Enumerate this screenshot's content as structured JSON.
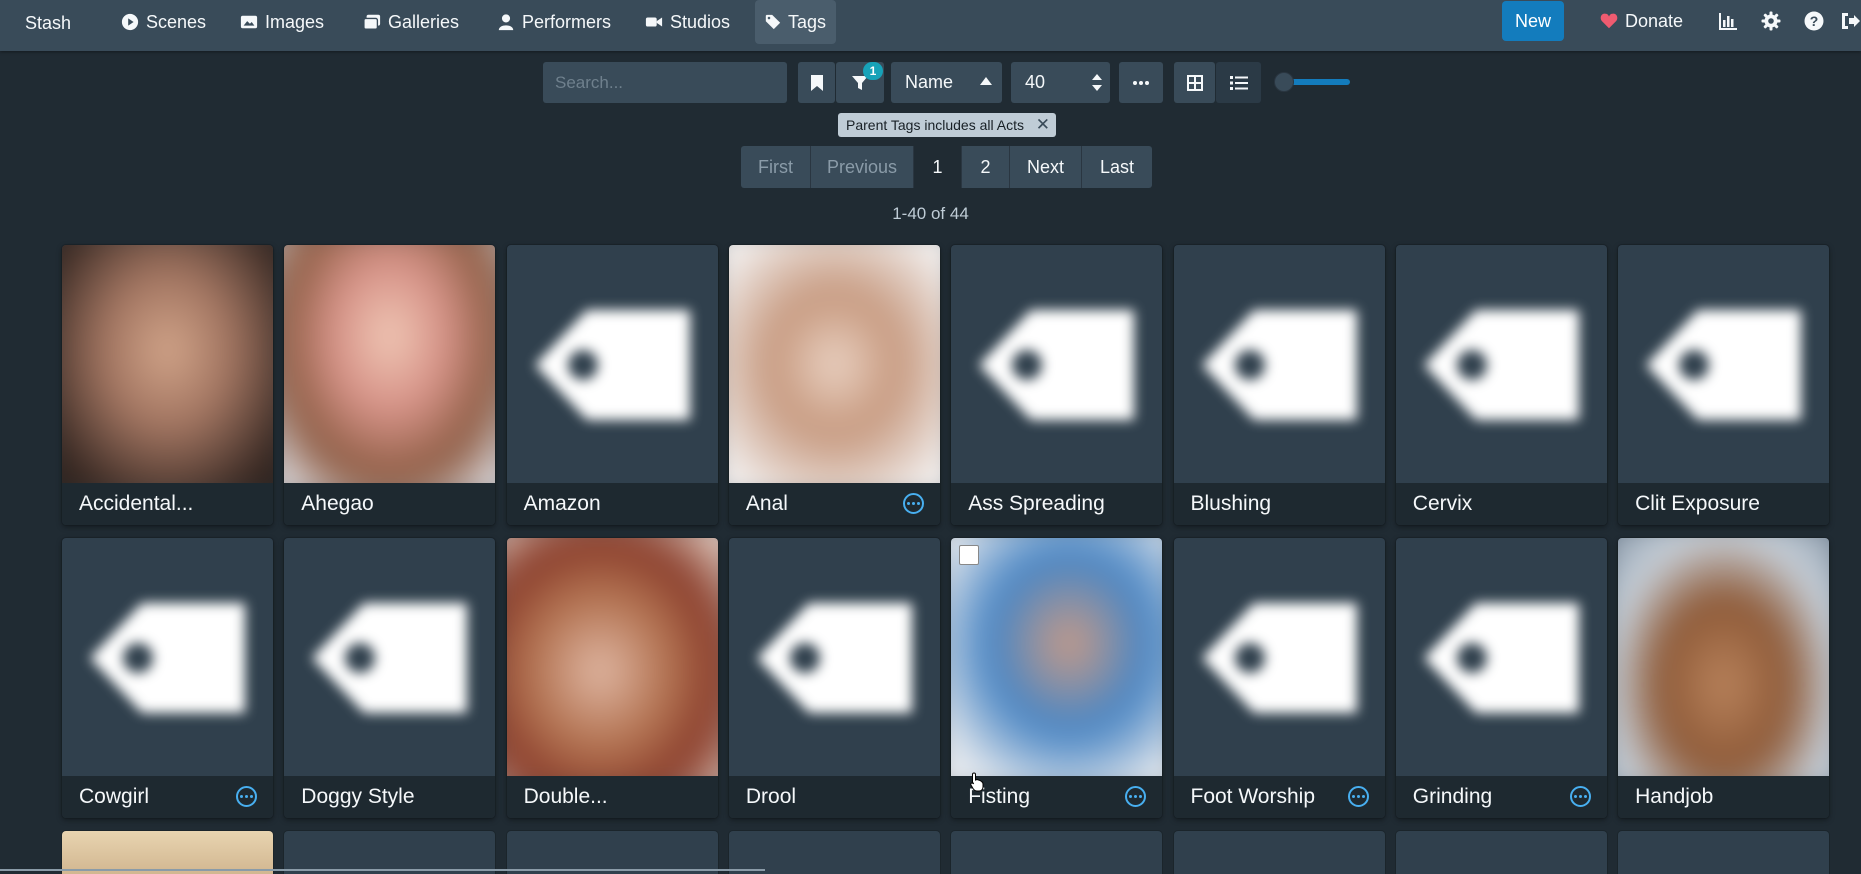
{
  "navbar": {
    "brand": "Stash",
    "items": [
      {
        "label": "Scenes",
        "icon": "play-circle-icon"
      },
      {
        "label": "Images",
        "icon": "image-icon"
      },
      {
        "label": "Galleries",
        "icon": "images-icon"
      },
      {
        "label": "Performers",
        "icon": "user-icon"
      },
      {
        "label": "Studios",
        "icon": "video-icon"
      },
      {
        "label": "Tags",
        "icon": "tag-icon",
        "active": true
      }
    ],
    "new_label": "New",
    "donate_label": "Donate",
    "right_icons": [
      "stats-icon",
      "settings-icon",
      "help-icon",
      "logout-icon"
    ]
  },
  "toolbar": {
    "search_placeholder": "Search...",
    "filter_count": "1",
    "sort_by": "Name",
    "per_page": "40",
    "zoom_level": 0
  },
  "filters": {
    "chip_label": "Parent Tags includes all Acts"
  },
  "pagination": {
    "first": "First",
    "previous": "Previous",
    "pages": [
      "1",
      "2"
    ],
    "current": "1",
    "next": "Next",
    "last": "Last",
    "count_label": "1-40 of 44"
  },
  "tags": [
    {
      "name": "Accidental...",
      "image": "photo",
      "menu": false
    },
    {
      "name": "Ahegao",
      "image": "photo",
      "menu": false
    },
    {
      "name": "Amazon",
      "image": "placeholder",
      "menu": false
    },
    {
      "name": "Anal",
      "image": "photo",
      "menu": true
    },
    {
      "name": "Ass Spreading",
      "image": "placeholder",
      "menu": false
    },
    {
      "name": "Blushing",
      "image": "placeholder",
      "menu": false
    },
    {
      "name": "Cervix",
      "image": "placeholder",
      "menu": false
    },
    {
      "name": "Clit Exposure",
      "image": "placeholder",
      "menu": false
    },
    {
      "name": "Cowgirl",
      "image": "placeholder",
      "menu": true
    },
    {
      "name": "Doggy Style",
      "image": "placeholder",
      "menu": false
    },
    {
      "name": "Double...",
      "image": "photo",
      "menu": false
    },
    {
      "name": "Drool",
      "image": "placeholder",
      "menu": false
    },
    {
      "name": "Fisting",
      "image": "photo",
      "menu": true,
      "checkbox": true
    },
    {
      "name": "Foot Worship",
      "image": "placeholder",
      "menu": true
    },
    {
      "name": "Grinding",
      "image": "placeholder",
      "menu": true
    },
    {
      "name": "Handjob",
      "image": "photo",
      "menu": false
    }
  ]
}
